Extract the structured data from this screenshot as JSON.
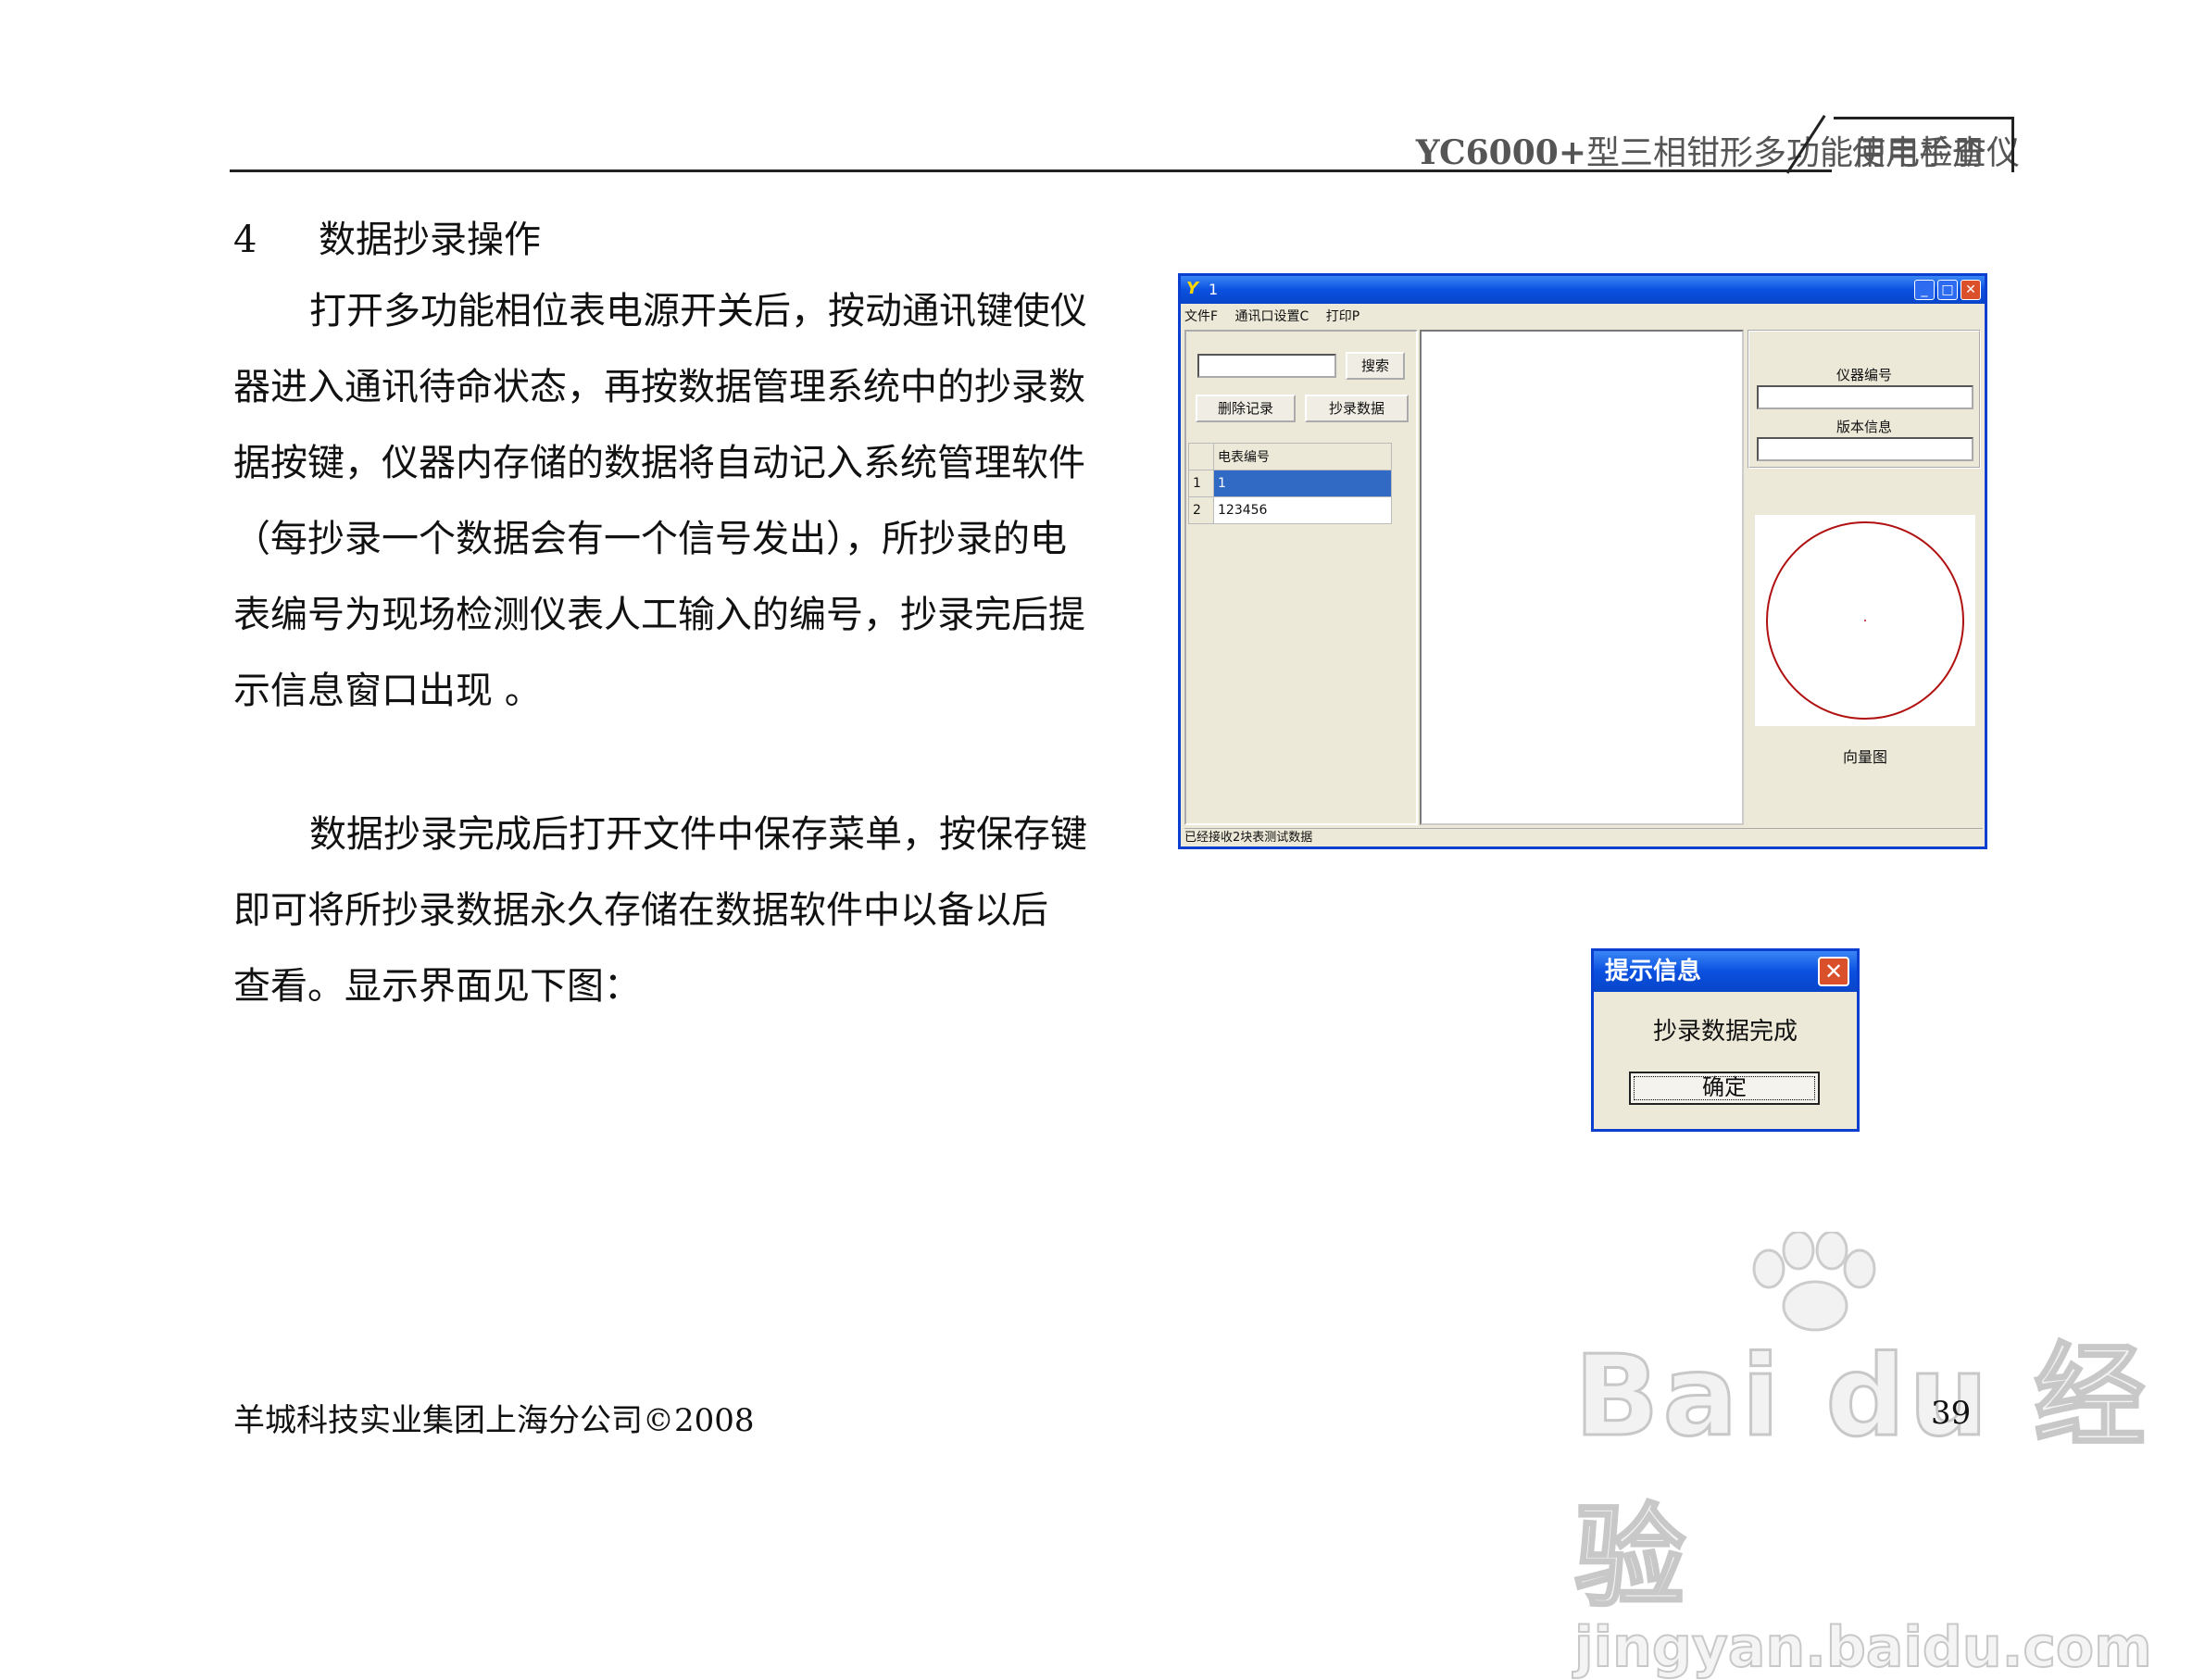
{
  "header": {
    "brand": "YC6000+",
    "title": "型三相钳形多功能用电检查仪",
    "subtitle": "使用手册"
  },
  "section": {
    "number": "4",
    "title": "数据抄录操作"
  },
  "paragraph1": [
    "打开多功能相位表电源开关后，按动通讯键使仪",
    "器进入通讯待命状态，再按数据管理系统中的抄录数",
    "据按键，仪器内存储的数据将自动记入系统管理软件",
    "（每抄录一个数据会有一个信号发出），所抄录的电",
    "表编号为现场检测仪表人工输入的编号，抄录完后提",
    "示信息窗口出现  。"
  ],
  "paragraph2": [
    "数据抄录完成后打开文件中保存菜单，按保存键",
    "即可将所抄录数据永久存储在数据软件中以备以后",
    "查看。显示界面见下图："
  ],
  "footer": {
    "company": "羊城科技实业集团上海分公司©2008",
    "page": "39"
  },
  "watermark": {
    "brand": "Bai du 经验",
    "url": "jingyan.baidu.com"
  },
  "app": {
    "title": "1",
    "menu": [
      "文件F",
      "通讯口设置C",
      "打印P"
    ],
    "search_button": "搜索",
    "delete_button": "删除记录",
    "copy_button": "抄录数据",
    "grid_header": "电表编号",
    "rows": [
      {
        "idx": "1",
        "value": "1"
      },
      {
        "idx": "2",
        "value": "123456"
      }
    ],
    "instrument_label": "仪器编号",
    "version_label": "版本信息",
    "vector_label": "向量图",
    "status": "已经接收2块表测试数据",
    "accent": "#0a50e0",
    "circle_color": "#b01010"
  },
  "dialog": {
    "title": "提示信息",
    "message": "抄录数据完成",
    "ok": "确定"
  }
}
